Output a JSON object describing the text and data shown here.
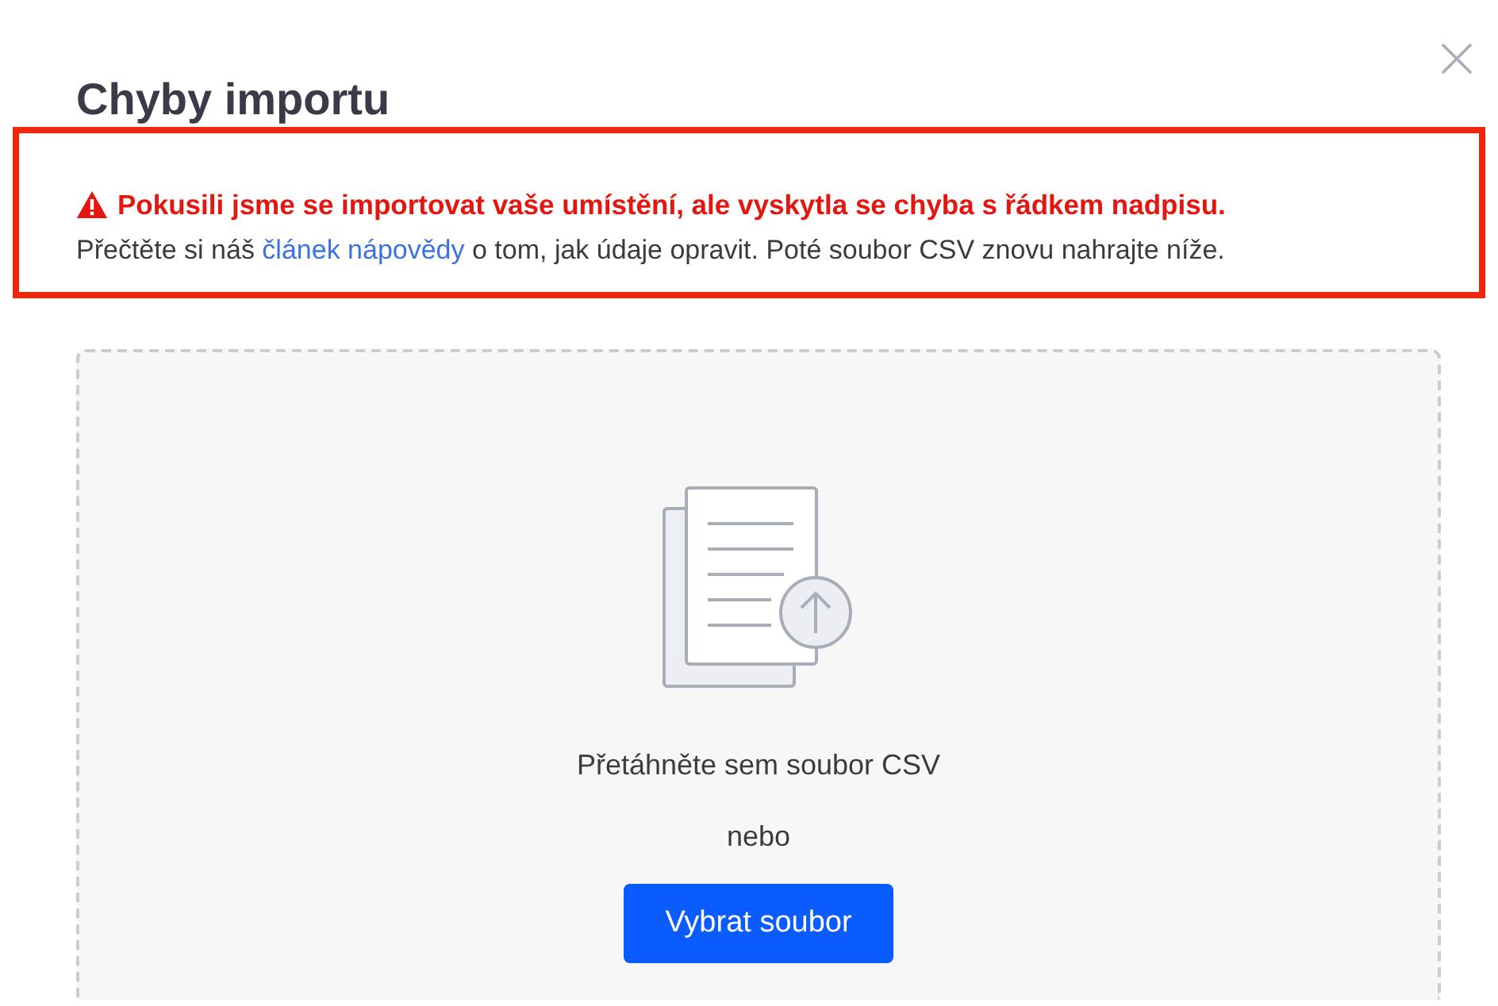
{
  "dialog": {
    "title": "Chyby importu"
  },
  "alert": {
    "heading": "Pokusili jsme se importovat vaše umístění, ale vyskytla se chyba s řádkem nadpisu.",
    "text_before": "Přečtěte si náš ",
    "link": "článek nápovědy",
    "text_after": " o tom, jak údaje opravit. Poté soubor CSV znovu nahrajte níže."
  },
  "dropzone": {
    "prompt": "Přetáhněte sem soubor CSV",
    "separator": "nebo",
    "button": "Vybrat soubor"
  }
}
